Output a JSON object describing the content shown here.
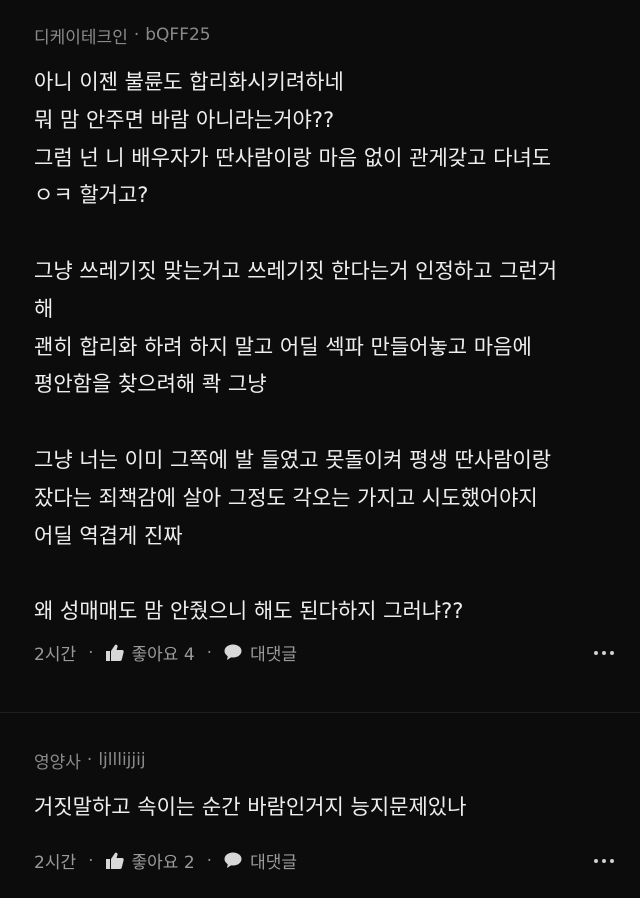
{
  "comments": [
    {
      "author": "디케이테크인",
      "handle": "bQFF25",
      "lines": [
        "아니 이젠 불륜도 합리화시키려하네",
        "뭐 맘 안주면 바람 아니라는거야??",
        "그럼 넌 니 배우자가 딴사람이랑 마음 없이 관게갖고 다녀도",
        "ㅇㅋ 할거고?",
        "",
        "그냥 쓰레기짓 맞는거고 쓰레기짓 한다는거 인정하고 그런거",
        "해",
        "괜히 합리화 하려 하지 말고 어딜 섹파 만들어놓고 마음에",
        "평안함을 찾으려해 콱 그냥",
        "",
        "그냥 너는 이미 그쪽에 발 들였고 못돌이켜 평생 딴사람이랑",
        "잤다는 죄책감에 살아 그정도 각오는 가지고 시도했어야지",
        "어딜 역겹게 진짜",
        "",
        "왜 성매매도 맘 안줬으니 해도 된다하지 그러냐??"
      ],
      "time": "2시간",
      "like_label": "좋아요 4",
      "reply_label": "대댓글"
    },
    {
      "author": "영양사",
      "handle": "ljlllijjij",
      "lines": [
        "거짓말하고 속이는 순간 바람인거지 능지문제있나"
      ],
      "time": "2시간",
      "like_label": "좋아요 2",
      "reply_label": "대댓글"
    }
  ],
  "separator_dot": "·",
  "icons": {
    "like": "thumbs-up-icon",
    "reply": "speech-bubble-icon",
    "more": "more-dots-icon"
  }
}
